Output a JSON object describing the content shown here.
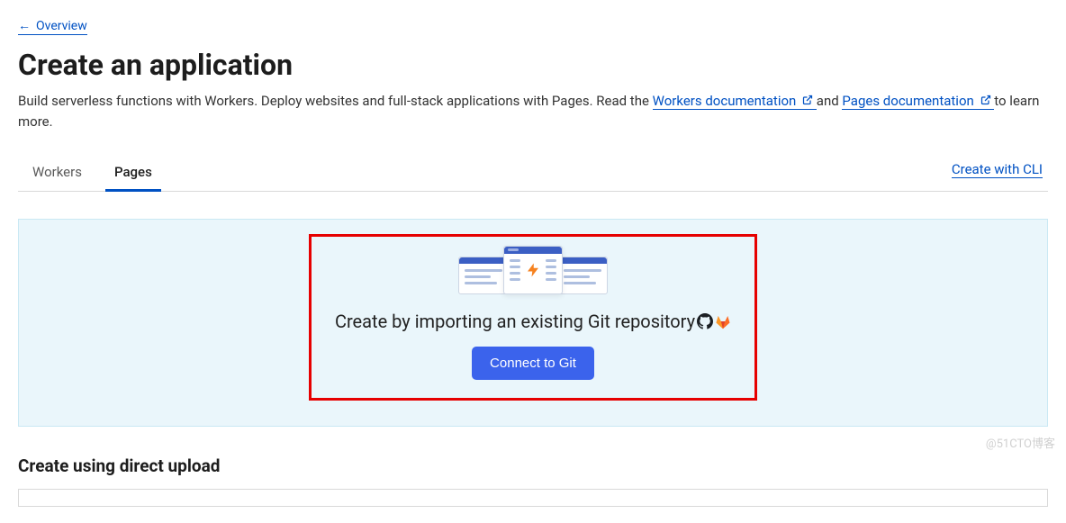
{
  "nav": {
    "back_label": "Overview"
  },
  "header": {
    "title": "Create an application",
    "subtitle_pre": "Build serverless functions with Workers. Deploy websites and full-stack applications with Pages. Read the ",
    "workers_link": "Workers documentation",
    "subtitle_mid": " and ",
    "pages_link": "Pages documentation",
    "subtitle_post": " to learn more."
  },
  "tabs": {
    "items": [
      {
        "label": "Workers",
        "active": false
      },
      {
        "label": "Pages",
        "active": true
      }
    ],
    "cli_link": "Create with CLI"
  },
  "import_card": {
    "title": "Create by importing an existing Git repository",
    "button": "Connect to Git"
  },
  "upload": {
    "heading": "Create using direct upload"
  },
  "watermark": "@51CTO博客"
}
